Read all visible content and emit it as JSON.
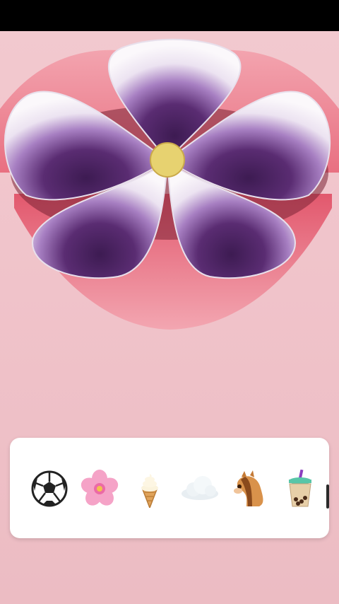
{
  "video": {
    "scene": "lips-with-flower-candy",
    "colors": {
      "skin": "#f0c4cb",
      "lip": "#ec7f8f",
      "petal_white": "#f7f2f7",
      "petal_purple": "#b48ac9",
      "petal_dark": "#4c2360",
      "center": "#e7d270"
    }
  },
  "emoji_picker": {
    "items": [
      {
        "name": "soccer-ball-icon"
      },
      {
        "name": "cherry-blossom-icon"
      },
      {
        "name": "soft-ice-cream-icon"
      },
      {
        "name": "cloud-icon"
      },
      {
        "name": "horse-face-icon"
      },
      {
        "name": "bubble-tea-icon"
      }
    ]
  }
}
